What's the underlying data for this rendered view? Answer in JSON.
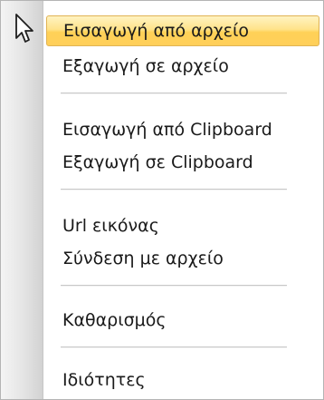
{
  "menu": {
    "items": [
      {
        "label": "Εισαγωγή από αρχείο",
        "highlighted": true
      },
      {
        "label": "Εξαγωγή σε αρχείο"
      },
      {
        "label": "Εισαγωγή από Clipboard"
      },
      {
        "label": "Εξαγωγή σε Clipboard"
      },
      {
        "label": "Url εικόνας"
      },
      {
        "label": "Σύνδεση με αρχείο"
      },
      {
        "label": "Καθαρισμός"
      },
      {
        "label": "Ιδιότητες"
      }
    ]
  },
  "colors": {
    "highlight": "#ffd966",
    "highlight_border": "#e0b354",
    "text": "#1a1a1a",
    "gutter": "#e4e4e4",
    "separator": "#c8c8c8"
  },
  "icons": {
    "cursor": "arrow-cursor-icon"
  }
}
